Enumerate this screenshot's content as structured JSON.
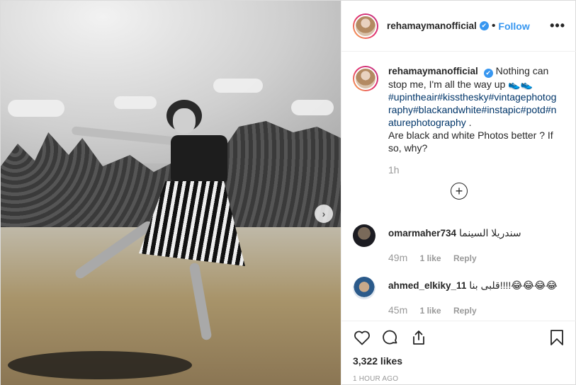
{
  "post": {
    "username": "rehamaymanofficial",
    "verified_mark": "✔",
    "dot": "•",
    "follow_label": "Follow",
    "more_label": "•••",
    "caption_text": "Nothing can stop me, I'm all the way up 👟👟",
    "hashtags": "#upintheair#kissthesky#vintagephotography#blackandwhite#instapic#potd#naturephotography",
    "caption_tail": ".",
    "caption_question": "Are black and white Photos better ? If so, why?",
    "time_ago": "1h",
    "load_more_label": "+",
    "next_label": "›"
  },
  "comments": [
    {
      "username": "omarmaher734",
      "text": "سندريلا السينما",
      "age": "49m",
      "likes": "1 like",
      "reply": "Reply"
    },
    {
      "username": "ahmed_elkiky_11",
      "text": "قلبى بنا!!!!😂😂😂😂",
      "age": "45m",
      "likes": "1 like",
      "reply": "Reply"
    }
  ],
  "footer": {
    "likes": "3,322 likes",
    "posted": "1 HOUR AGO"
  },
  "icons": [
    "heart-icon",
    "comment-icon",
    "share-icon",
    "bookmark-icon",
    "chevron-right-icon",
    "plus-circle-icon",
    "more-icon",
    "verified-icon"
  ],
  "colors": {
    "link": "#3897f0",
    "hashtag": "#003569",
    "muted": "#999999",
    "text": "#262626"
  }
}
